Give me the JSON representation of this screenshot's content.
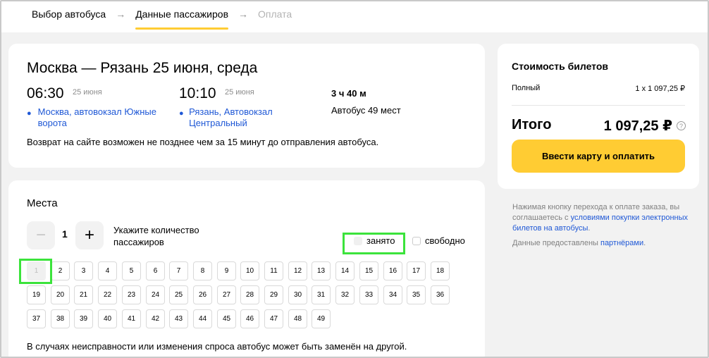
{
  "breadcrumbs": {
    "step1": "Выбор автобуса",
    "step2": "Данные пассажиров",
    "step3": "Оплата"
  },
  "trip": {
    "title": "Москва — Рязань  25 июня, среда",
    "departure_time": "06:30",
    "departure_date": "25 июня",
    "departure_station": "Москва, автовокзал Южные ворота",
    "arrival_time": "10:10",
    "arrival_date": "25 июня",
    "arrival_station": "Рязань, Автовокзал Центральный",
    "duration": "3 ч 40 м",
    "bus": "Автобус 49 мест",
    "refund_note": "Возврат на сайте возможен не позднее чем за 15 минут до отправления автобуса."
  },
  "seats": {
    "title": "Места",
    "quantity": "1",
    "minus_label": "−",
    "plus_label": "+",
    "hint": "Укажите количество пассажиров",
    "legend_busy": "занято",
    "legend_free": "свободно",
    "numbers": [
      "1",
      "2",
      "3",
      "4",
      "5",
      "6",
      "7",
      "8",
      "9",
      "10",
      "11",
      "12",
      "13",
      "14",
      "15",
      "16",
      "17",
      "18",
      "19",
      "20",
      "21",
      "22",
      "23",
      "24",
      "25",
      "26",
      "27",
      "28",
      "29",
      "30",
      "31",
      "32",
      "33",
      "34",
      "35",
      "36",
      "37",
      "38",
      "39",
      "40",
      "41",
      "42",
      "43",
      "44",
      "45",
      "46",
      "47",
      "48",
      "49"
    ],
    "occupied": [
      "1"
    ],
    "note": "В случаях неисправности или изменения спроса автобус может быть заменён на другой."
  },
  "price": {
    "title": "Стоимость билетов",
    "row_label": "Полный",
    "row_value": "1 x 1 097,25 ₽",
    "total_label": "Итого",
    "total_value": "1 097,25 ₽",
    "help": "?",
    "pay_button": "Ввести карту и оплатить"
  },
  "terms": {
    "text_before": "Нажимая кнопку перехода к оплате заказа, вы соглашаетесь с ",
    "link": "условиями покупки электронных билетов на автобусы",
    "text_after": ".",
    "partners_before": "Данные предоставлены ",
    "partners_link": "партнёрами",
    "partners_after": "."
  },
  "colors": {
    "accent_yellow": "#ffcc33",
    "link_blue": "#1f58d6",
    "highlight_green": "#3be33b"
  }
}
